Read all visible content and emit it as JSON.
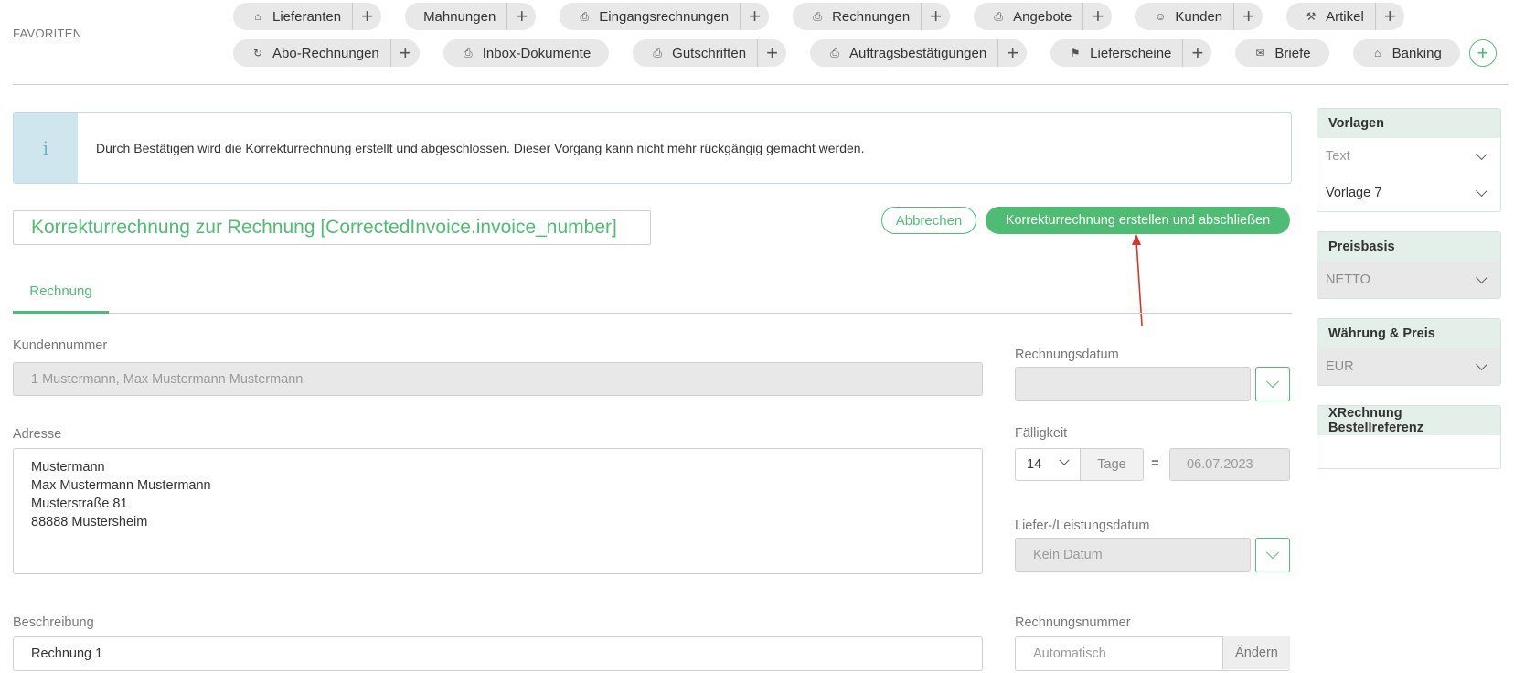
{
  "favorites": {
    "label": "FAVORITEN",
    "row1": [
      {
        "label": "Lieferanten",
        "icon": "supplier-icon",
        "plus": true
      },
      {
        "label": "Mahnungen",
        "icon": "",
        "plus": true
      },
      {
        "label": "Eingangsrechnungen",
        "icon": "incoming-invoice-icon",
        "plus": true
      },
      {
        "label": "Rechnungen",
        "icon": "invoice-icon",
        "plus": true
      },
      {
        "label": "Angebote",
        "icon": "offer-icon",
        "plus": true
      },
      {
        "label": "Kunden",
        "icon": "customers-icon",
        "plus": true
      },
      {
        "label": "Artikel",
        "icon": "article-icon",
        "plus": true
      }
    ],
    "row2": [
      {
        "label": "Abo-Rechnungen",
        "icon": "subscription-invoice-icon",
        "plus": true
      },
      {
        "label": "Inbox-Dokumente",
        "icon": "inbox-document-icon",
        "plus": false
      },
      {
        "label": "Gutschriften",
        "icon": "credit-note-icon",
        "plus": true
      },
      {
        "label": "Auftragsbestätigungen",
        "icon": "order-confirmation-icon",
        "plus": true
      },
      {
        "label": "Lieferscheine",
        "icon": "delivery-note-icon",
        "plus": true
      },
      {
        "label": "Briefe",
        "icon": "letter-icon",
        "plus": false
      },
      {
        "label": "Banking",
        "icon": "bank-icon",
        "plus": false
      }
    ]
  },
  "info": {
    "icon": "i",
    "message": "Durch Bestätigen wird die Korrekturrechnung erstellt und abgeschlossen. Dieser Vorgang kann nicht mehr rückgängig gemacht werden."
  },
  "document": {
    "title": "Korrekturrechnung zur Rechnung [CorrectedInvoice.invoice_number]",
    "cancel_label": "Abbrechen",
    "confirm_label": "Korrekturrechnung erstellen und abschließen"
  },
  "tabs": {
    "active": "Rechnung"
  },
  "form": {
    "customer_number_label": "Kundennummer",
    "customer_number_value": "1 Mustermann, Max Mustermann Mustermann",
    "address_label": "Adresse",
    "address_lines": [
      "Mustermann",
      "Max Mustermann Mustermann",
      "Musterstraße 81",
      "88888 Mustersheim"
    ],
    "description_label": "Beschreibung",
    "description_value": "Rechnung 1",
    "invoice_date_label": "Rechnungsdatum",
    "invoice_date_value": "",
    "due_label": "Fälligkeit",
    "due_days": "14",
    "due_unit": "Tage",
    "due_eq": "=",
    "due_date": "06.07.2023",
    "delivery_date_label": "Liefer-/Leistungsdatum",
    "delivery_date_placeholder": "Kein Datum",
    "invoice_number_label": "Rechnungsnummer",
    "invoice_number_placeholder": "Automatisch",
    "invoice_number_change": "Ändern"
  },
  "sidebar": {
    "templates_title": "Vorlagen",
    "templates_text": "Text",
    "templates_value": "Vorlage 7",
    "price_basis_title": "Preisbasis",
    "price_basis_value": "NETTO",
    "currency_title": "Währung & Preis",
    "currency_value": "EUR",
    "xrechnung_title": "XRechnung Bestellreferenz",
    "xrechnung_value": ""
  },
  "colors": {
    "accent": "#4ebd73",
    "info_bg": "#cfe6ef",
    "annotation_arrow": "#d9342b"
  }
}
